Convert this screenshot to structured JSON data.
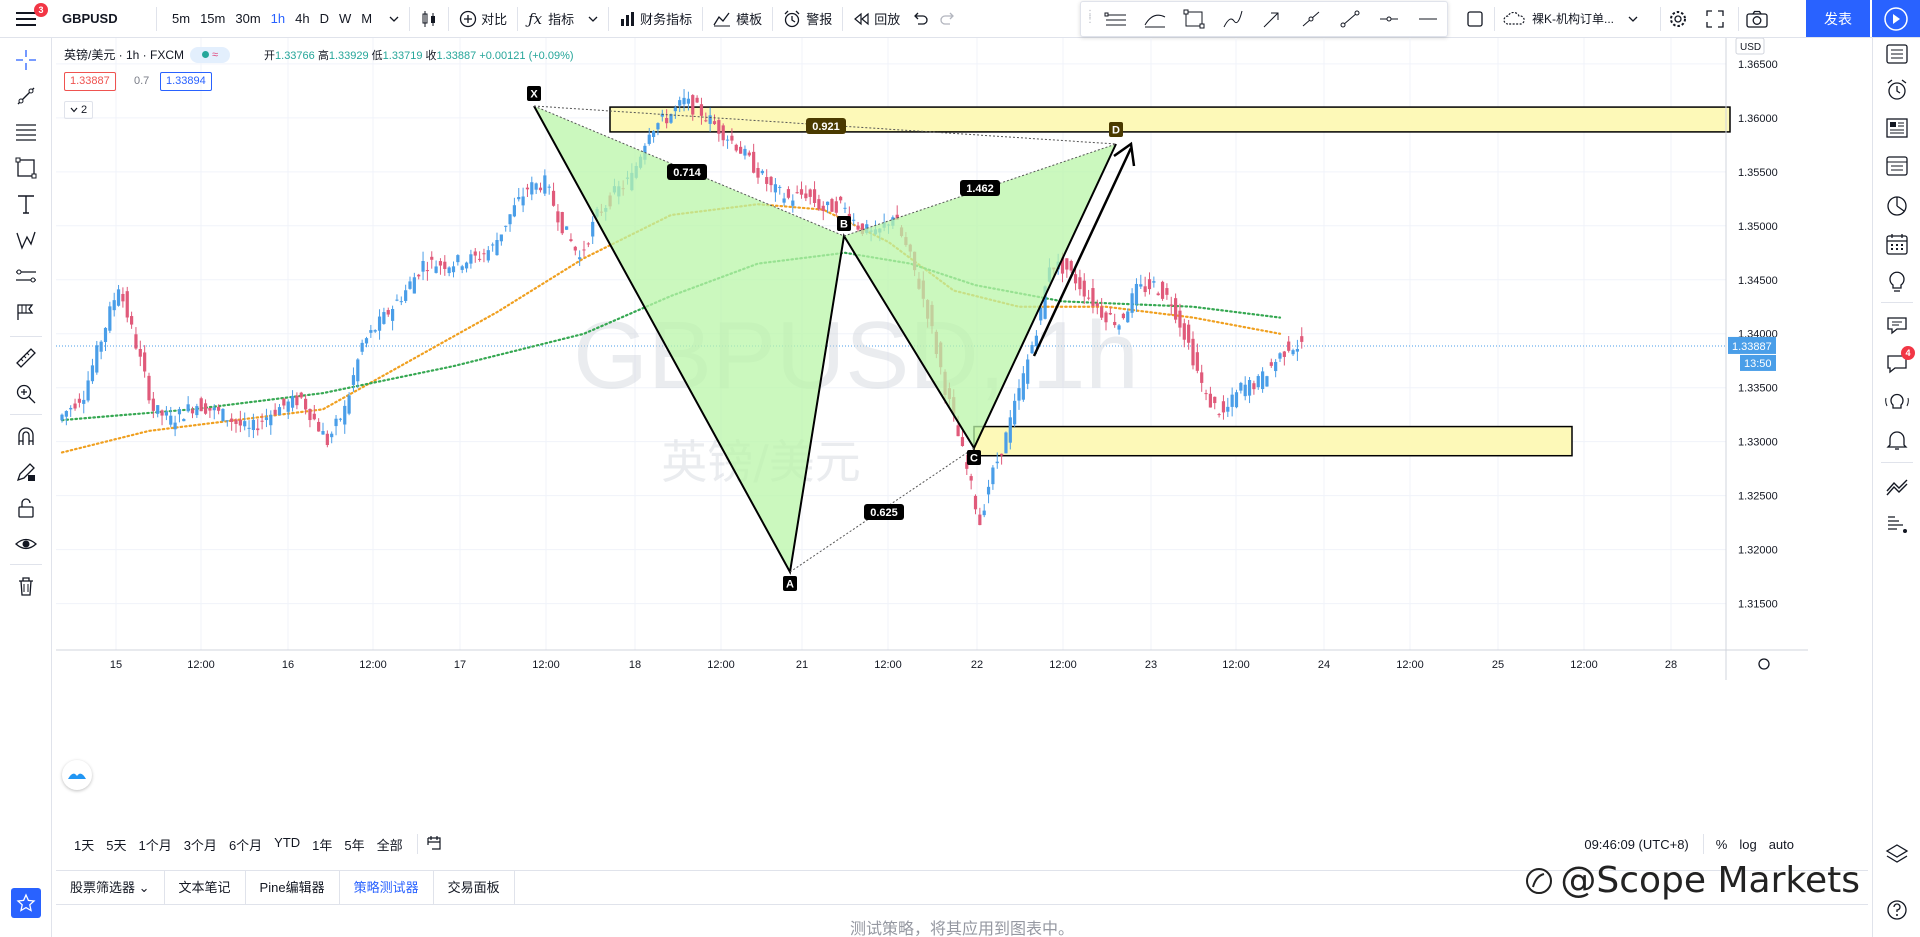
{
  "toolbar": {
    "notification_count": "3",
    "symbol": "GBPUSD",
    "intervals": [
      "5m",
      "15m",
      "30m",
      "1h",
      "4h",
      "D",
      "W",
      "M"
    ],
    "active_interval": "1h",
    "compare_label": "对比",
    "indicators_label": "指标",
    "financials_label": "财务指标",
    "templates_label": "模板",
    "alert_label": "警报",
    "replay_label": "回放",
    "layout_name": "裸K-机构订单...",
    "publish_label": "发表"
  },
  "legend": {
    "title": "英镑/美元 · 1h · FXCM",
    "open_label": "开",
    "open": "1.33766",
    "high_label": "高",
    "high": "1.33929",
    "low_label": "低",
    "low": "1.33719",
    "close_label": "收",
    "close": "1.33887",
    "change": "+0.00121 (+0.09%)",
    "bid": "1.33887",
    "spread": "0.7",
    "ask": "1.33894",
    "collapse_count": "2"
  },
  "watermark": {
    "symbol": "GBPUSD, 1h",
    "name": "英镑/美元"
  },
  "price_axis": {
    "currency": "USD",
    "ticks": [
      "1.36500",
      "1.36000",
      "1.35500",
      "1.35000",
      "1.34500",
      "1.34000",
      "1.33500",
      "1.33000",
      "1.32500",
      "1.32000",
      "1.31500"
    ],
    "last_price": "1.33887",
    "countdown": "13:50"
  },
  "time_axis": {
    "ticks": [
      "15",
      "12:00",
      "16",
      "12:00",
      "17",
      "12:00",
      "18",
      "12:00",
      "21",
      "12:00",
      "22",
      "12:00",
      "23",
      "12:00",
      "24",
      "12:00",
      "25",
      "12:00",
      "28"
    ]
  },
  "pattern": {
    "points": [
      "X",
      "A",
      "B",
      "C",
      "D"
    ],
    "ratios": [
      "0.921",
      "0.714",
      "1.462",
      "0.625"
    ]
  },
  "range_buttons": [
    "1天",
    "5天",
    "1个月",
    "3个月",
    "6个月",
    "YTD",
    "1年",
    "5年",
    "全部"
  ],
  "clock": "09:46:09 (UTC+8)",
  "scale_options": [
    "%",
    "log",
    "auto"
  ],
  "bottom_tabs": [
    "股票筛选器",
    "文本笔记",
    "Pine编辑器",
    "策略测试器",
    "交易面板"
  ],
  "active_bottom_tab": "策略测试器",
  "empty_message": "测试策略，将其应用到图表中。",
  "chat_badge": "4",
  "brand_watermark": "@Scope Markets",
  "colors": {
    "accent": "#2962ff",
    "up": "#4a9ee8",
    "down": "#e05a7a",
    "pattern_fill": "#b9f5a8",
    "zone_fill": "#fdf9b8",
    "ma_orange": "#f0a020",
    "ma_green": "#36a852"
  }
}
